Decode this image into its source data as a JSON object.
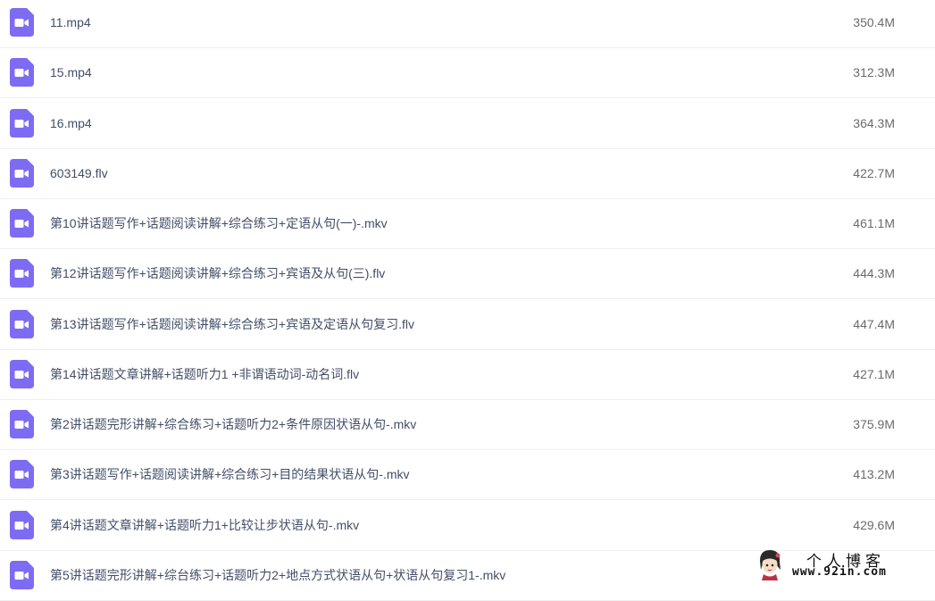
{
  "files": [
    {
      "name": "11.mp4",
      "size": "350.4M",
      "icon": "video-file-icon"
    },
    {
      "name": "15.mp4",
      "size": "312.3M",
      "icon": "video-file-icon"
    },
    {
      "name": "16.mp4",
      "size": "364.3M",
      "icon": "video-file-icon"
    },
    {
      "name": "603149.flv",
      "size": "422.7M",
      "icon": "video-file-icon"
    },
    {
      "name": "第10讲话题写作+话题阅读讲解+综合练习+定语从句(一)-.mkv",
      "size": "461.1M",
      "icon": "video-file-icon"
    },
    {
      "name": "第12讲话题写作+话题阅读讲解+综合练习+宾语及从句(三).flv",
      "size": "444.3M",
      "icon": "video-file-icon"
    },
    {
      "name": "第13讲话题写作+话题阅读讲解+综合练习+宾语及定语从句复习.flv",
      "size": "447.4M",
      "icon": "video-file-icon"
    },
    {
      "name": "第14讲话题文章讲解+话题听力1 +非谓语动词-动名词.flv",
      "size": "427.1M",
      "icon": "video-file-icon"
    },
    {
      "name": "第2讲话题完形讲解+综合练习+话题听力2+条件原因状语从句-.mkv",
      "size": "375.9M",
      "icon": "video-file-icon"
    },
    {
      "name": "第3讲话题写作+话题阅读讲解+综合练习+目的结果状语从句-.mkv",
      "size": "413.2M",
      "icon": "video-file-icon"
    },
    {
      "name": "第4讲话题文章讲解+话题听力1+比较让步状语从句-.mkv",
      "size": "429.6M",
      "icon": "video-file-icon"
    },
    {
      "name": "第5讲话题完形讲解+综台练习+话题听力2+地点方式状语从句+状语从句复习1-.mkv",
      "size": "",
      "icon": "video-file-icon"
    }
  ],
  "watermark": {
    "title": "个人博客",
    "url": "www.92in.com"
  },
  "colors": {
    "icon_purple": "#7d6cf3",
    "filename_text": "#424e67",
    "size_text": "#6b6b6b",
    "row_divider": "#efefef"
  }
}
